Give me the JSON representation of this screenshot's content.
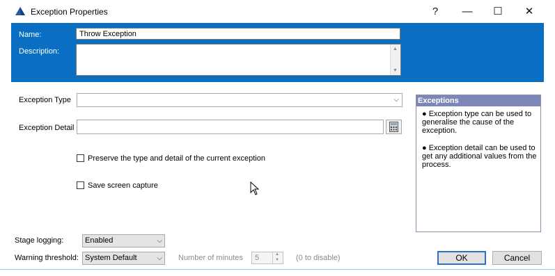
{
  "window": {
    "title": "Exception Properties",
    "help_glyph": "?",
    "minimize_glyph": "—",
    "maximize_glyph": "☐",
    "close_glyph": "✕",
    "header_color": "#0a6fc2"
  },
  "header": {
    "name_label": "Name:",
    "name_value": "Throw Exception",
    "description_label": "Description:",
    "description_value": ""
  },
  "form": {
    "exception_type_label": "Exception Type",
    "exception_type_value": "",
    "exception_detail_label": "Exception Detail",
    "exception_detail_value": "",
    "preserve_checkbox": {
      "label": "Preserve the type and detail of the current exception",
      "checked": false
    },
    "screen_capture_checkbox": {
      "label": "Save screen capture",
      "checked": false
    }
  },
  "exceptions_panel": {
    "title": "Exceptions",
    "bullet1": "● Exception type can be used to generalise the cause of the exception.",
    "bullet2": "● Exception detail can be used to get any additional values from the process."
  },
  "footer": {
    "stage_logging_label": "Stage logging:",
    "stage_logging_value": "Enabled",
    "warning_threshold_label": "Warning threshold:",
    "warning_threshold_value": "System Default",
    "minutes_label": "Number of minutes",
    "minutes_value": "5",
    "disable_hint": "(0 to disable)",
    "ok_label": "OK",
    "cancel_label": "Cancel"
  },
  "icons": {
    "app": "blue-prism-icon",
    "calculator": "calculator-icon",
    "dropdown": "chevron-down-icon"
  }
}
